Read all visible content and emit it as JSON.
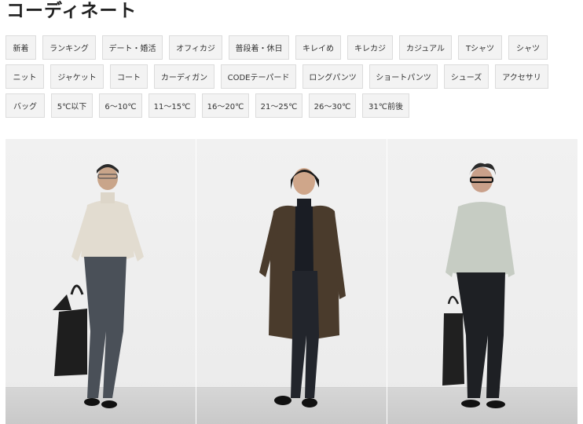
{
  "page": {
    "title": "コーディネート"
  },
  "tags": {
    "row1": [
      "新着",
      "ランキング",
      "デート・婚活",
      "オフィカジ",
      "普段着・休日",
      "キレイめ",
      "キレカジ",
      "カジュアル",
      "Tシャツ",
      "シャツ"
    ],
    "row2": [
      "ニット",
      "ジャケット",
      "コート",
      "カーディガン",
      "CODEテーパード",
      "ロングパンツ",
      "ショートパンツ",
      "シューズ",
      "アクセサリ"
    ],
    "row3": [
      "バッグ",
      "5℃以下",
      "6〜10℃",
      "11〜15℃",
      "16〜20℃",
      "21〜25℃",
      "26〜30℃",
      "31℃前後"
    ]
  },
  "photos": [
    {
      "sweater": "#e2dcd0",
      "pants": "#4a5058",
      "bag": "#1e1e1e"
    },
    {
      "coat": "#4a3b2c",
      "inner": "#1a1d24",
      "pants": "#22252c"
    },
    {
      "sweater": "#c6ccc3",
      "pants": "#1e2024",
      "bag": "#202020"
    }
  ]
}
